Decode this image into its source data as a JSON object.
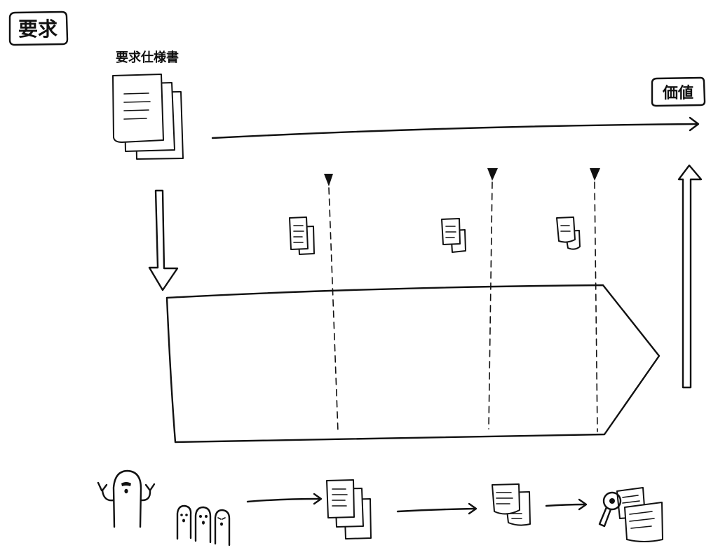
{
  "labels": {
    "requirement": "要求",
    "requirement_spec": "要求仕様書",
    "value": "価値"
  },
  "colors": {
    "ink": "#111111",
    "paper": "#ffffff"
  }
}
